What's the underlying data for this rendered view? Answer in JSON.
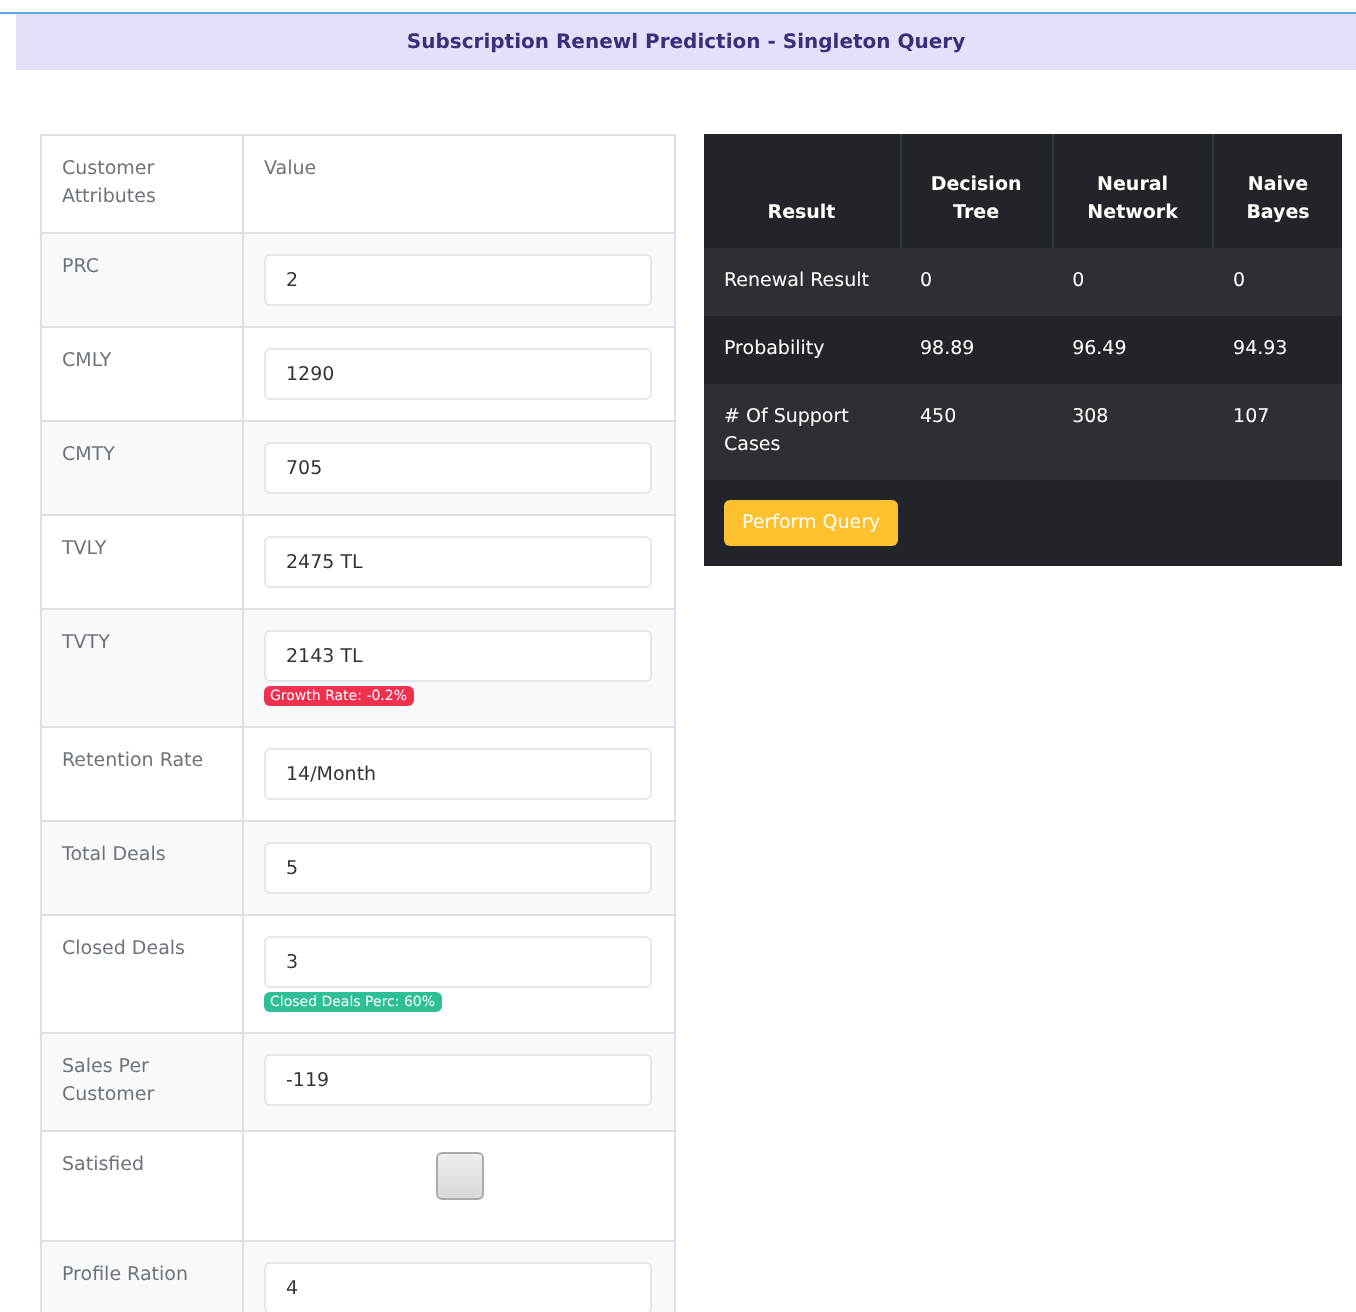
{
  "header": {
    "title": "Subscription Renewl Prediction - Singleton Query"
  },
  "attributes": {
    "columns": [
      "Customer Attributes",
      "Value"
    ],
    "rows": [
      {
        "kind": "input",
        "label": "PRC",
        "value": "2"
      },
      {
        "kind": "input",
        "label": "CMLY",
        "value": "1290"
      },
      {
        "kind": "input",
        "label": "CMTY",
        "value": "705"
      },
      {
        "kind": "input",
        "label": "TVLY",
        "value": "2475 TL"
      },
      {
        "kind": "input",
        "label": "TVTY",
        "value": "2143 TL",
        "badge": {
          "text": "Growth Rate: -0.2%",
          "color": "#f0304f"
        }
      },
      {
        "kind": "input",
        "label": "Retention Rate",
        "value": "14/Month"
      },
      {
        "kind": "input",
        "label": "Total Deals",
        "value": "5"
      },
      {
        "kind": "input",
        "label": "Closed Deals",
        "value": "3",
        "badge": {
          "text": "Closed Deals Perc: 60%",
          "color": "#2fbf96"
        }
      },
      {
        "kind": "input",
        "label": "Sales Per Customer",
        "value": "-119"
      },
      {
        "kind": "checkbox",
        "label": "Satisfied",
        "checked": false
      },
      {
        "kind": "input",
        "label": "Profile Ration",
        "value": "4"
      }
    ]
  },
  "results": {
    "columns": [
      "Result",
      "Decision Tree",
      "Neural Network",
      "Naive Bayes"
    ],
    "rows": [
      [
        "Renewal Result",
        "0",
        "0",
        "0"
      ],
      [
        "Probability",
        "98.89",
        "96.49",
        "94.93"
      ],
      [
        "# Of Support Cases",
        "450",
        "308",
        "107"
      ]
    ],
    "button": "Perform Query"
  }
}
